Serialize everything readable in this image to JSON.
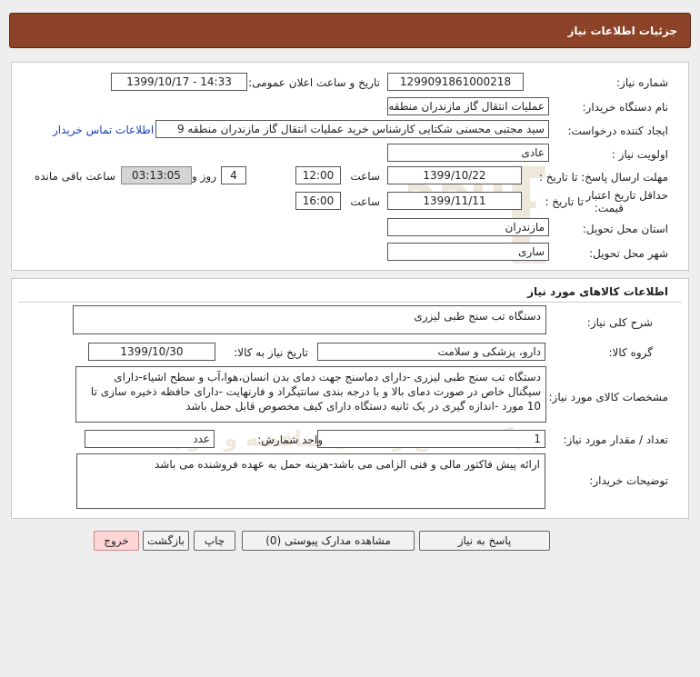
{
  "header": {
    "title": "جزئیات اطلاعات نیاز"
  },
  "need_info": {
    "need_number": {
      "label": "شماره نیاز:",
      "value": "1299091861000218"
    },
    "announce": {
      "label": "تاریخ و ساعت اعلان عمومی:",
      "value": "1399/10/17 - 14:33"
    },
    "buyer_org": {
      "label": "نام دستگاه خریدار:",
      "value": "عملیات انتقال گاز مازندران منطقه 9"
    },
    "requester": {
      "label": "ایجاد کننده درخواست:",
      "value": "سید مجتبی محسنی شکتایی کارشناس خرید عملیات انتقال گاز مازندران منطقه 9",
      "contact_link": "اطلاعات تماس خریدار"
    },
    "priority": {
      "label": "اولویت نیاز :",
      "value": "عادی"
    },
    "deadline": {
      "label": "مهلت ارسال پاسخ: تا تاریخ :",
      "date": "1399/10/22",
      "time_label": "ساعت",
      "time": "12:00",
      "days": "4",
      "days_label": "روز و",
      "remaining": "03:13:05",
      "remaining_label": "ساعت باقی مانده"
    },
    "price_validity": {
      "label_line1": "حداقل تاریخ اعتبار",
      "label_line2": "قیمت:",
      "until_label": "تا تاریخ :",
      "date": "1399/11/11",
      "time_label": "ساعت",
      "time": "16:00"
    },
    "province": {
      "label": "استان محل تحویل:",
      "value": "مازندران"
    },
    "city": {
      "label": "شهر محل تحویل:",
      "value": "ساری"
    }
  },
  "goods": {
    "section_title": "اطلاعات کالاهای مورد نیاز",
    "general_desc": {
      "label": "شرح کلی نیاز:",
      "value": "دستگاه تب سنج طبی لیزری"
    },
    "goods_group": {
      "label": "گروه کالا:",
      "value": "دارو، پزشکی و سلامت"
    },
    "need_date": {
      "label": "تاریخ نیاز به کالا:",
      "value": "1399/10/30"
    },
    "specs": {
      "label": "مشخصات کالای مورد نیاز:",
      "value": "دستگاه تب سنج طبی لیزری -دارای دماسنج  جهت دمای بدن انسان،هوا،آب و سطح اشیاء-دارای سیگنال خاص در صورت دمای بالا و با درجه بندی سانتیگراد و فارنهایت -دارای حافظه ذخیره سازی تا 10 مورد -اندازه گیری در یک ثانیه دستگاه دارای کیف مخصوص قابل حمل باشد"
    },
    "quantity": {
      "label": "تعداد / مقدار مورد نیاز:",
      "value": "1"
    },
    "unit": {
      "label": "واحد شمارش:",
      "value": "عدد"
    },
    "buyer_notes": {
      "label": "توضیحات خریدار:",
      "value": "ارائه پیش فاکتور مالی و فنی الزامی می باشد-هزینه حمل به عهده فروشنده می باشد"
    }
  },
  "buttons": {
    "reply": "پاسخ به نیاز",
    "attachments": "مشاهده مدارک پیوستی (0)",
    "print": "چاپ",
    "back": "بازگشت",
    "exit": "خروج"
  },
  "colors": {
    "header_bg": "#8b4226",
    "exit_bg": "#ffd6d6",
    "link": "#1a3fb0"
  }
}
